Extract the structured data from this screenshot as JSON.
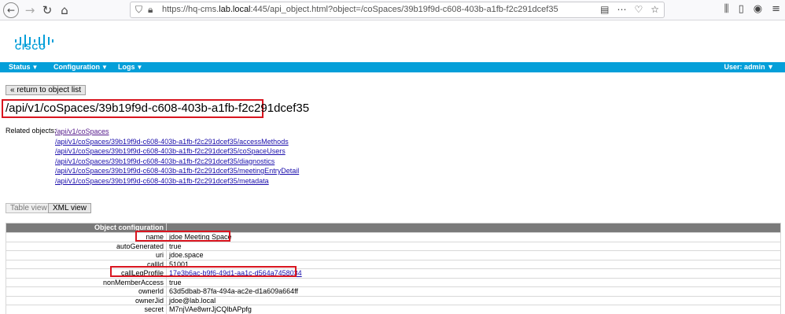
{
  "browser": {
    "url_prefix": "https://hq-cms.",
    "url_host": "lab.local",
    "url_suffix": ":445/api_object.html?object=/coSpaces/39b19f9d-c608-403b-a1fb-f2c291dcef35"
  },
  "brand": {
    "logo_text": "CISCO",
    "accent": "#049fd9"
  },
  "menu": {
    "items": [
      {
        "label": "Status"
      },
      {
        "label": "Configuration"
      },
      {
        "label": "Logs"
      }
    ],
    "user": "User: admin"
  },
  "page": {
    "return_button": "« return to object list",
    "title": "/api/v1/coSpaces/39b19f9d-c608-403b-a1fb-f2c291dcef35",
    "related_label": "Related objects:",
    "related": [
      "/api/v1/coSpaces",
      "/api/v1/coSpaces/39b19f9d-c608-403b-a1fb-f2c291dcef35/accessMethods",
      "/api/v1/coSpaces/39b19f9d-c608-403b-a1fb-f2c291dcef35/coSpaceUsers",
      "/api/v1/coSpaces/39b19f9d-c608-403b-a1fb-f2c291dcef35/diagnostics",
      "/api/v1/coSpaces/39b19f9d-c608-403b-a1fb-f2c291dcef35/meetingEntryDetail",
      "/api/v1/coSpaces/39b19f9d-c608-403b-a1fb-f2c291dcef35/metadata"
    ],
    "tabs": {
      "table": "Table view",
      "xml": "XML view"
    },
    "table_header": "Object configuration",
    "rows": [
      {
        "key": "name",
        "value": "jdoe Meeting Space"
      },
      {
        "key": "autoGenerated",
        "value": "true"
      },
      {
        "key": "uri",
        "value": "jdoe.space"
      },
      {
        "key": "callId",
        "value": "51001"
      },
      {
        "key": "callLegProfile",
        "value": "17e3b6ac-b9f6-49d1-aa1c-d564a7458034"
      },
      {
        "key": "nonMemberAccess",
        "value": "true"
      },
      {
        "key": "ownerId",
        "value": "63d5dbab-87fa-494a-ac2e-d1a609a664ff"
      },
      {
        "key": "ownerJid",
        "value": "jdoe@lab.local"
      },
      {
        "key": "secret",
        "value": "M7njVAe8wrrJjCQlbAPpfg"
      }
    ]
  }
}
